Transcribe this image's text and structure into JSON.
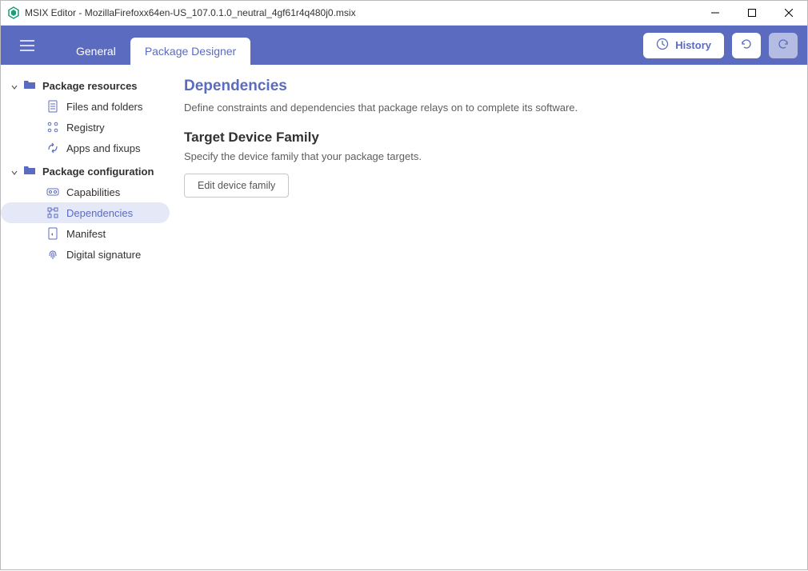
{
  "window": {
    "app_name": "MSIX Editor",
    "file_name": "MozillaFirefoxx64en-US_107.0.1.0_neutral_4gf61r4q480j0.msix"
  },
  "navbar": {
    "tab_general": "General",
    "tab_designer": "Package Designer",
    "history_label": "History"
  },
  "sidebar": {
    "group_resources": "Package resources",
    "item_files": "Files and folders",
    "item_registry": "Registry",
    "item_apps": "Apps and fixups",
    "group_config": "Package configuration",
    "item_capabilities": "Capabilities",
    "item_dependencies": "Dependencies",
    "item_manifest": "Manifest",
    "item_signature": "Digital signature"
  },
  "content": {
    "title": "Dependencies",
    "description": "Define constraints and dependencies that package relays on to complete its software.",
    "section_title": "Target Device Family",
    "section_desc": "Specify the device family that your package targets.",
    "edit_button": "Edit device family"
  }
}
